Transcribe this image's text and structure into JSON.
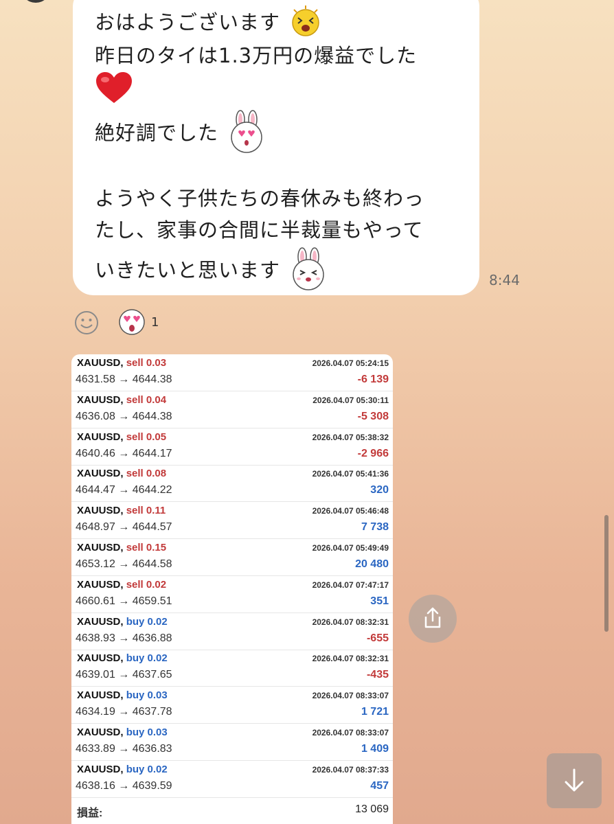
{
  "message": {
    "lines": [
      "おはようございます",
      "昨日のタイは1.3万円の爆益でした",
      "絶好調でした",
      "ようやく子供たちの春休みも終わっ",
      "たし、家事の合間に半裁量もやって",
      "いきたいと思います"
    ],
    "time": "8:44"
  },
  "reactions": {
    "count": "1"
  },
  "trade_screenshot": {
    "trades": [
      {
        "symbol": "XAUUSD,",
        "side": "sell",
        "lot": "0.03",
        "prices": "4631.58 → 4644.38",
        "time": "2026.04.07 05:24:15",
        "profit": "-6 139"
      },
      {
        "symbol": "XAUUSD,",
        "side": "sell",
        "lot": "0.04",
        "prices": "4636.08 → 4644.38",
        "time": "2026.04.07 05:30:11",
        "profit": "-5 308"
      },
      {
        "symbol": "XAUUSD,",
        "side": "sell",
        "lot": "0.05",
        "prices": "4640.46 → 4644.17",
        "time": "2026.04.07 05:38:32",
        "profit": "-2 966"
      },
      {
        "symbol": "XAUUSD,",
        "side": "sell",
        "lot": "0.08",
        "prices": "4644.47 → 4644.22",
        "time": "2026.04.07 05:41:36",
        "profit": "320"
      },
      {
        "symbol": "XAUUSD,",
        "side": "sell",
        "lot": "0.11",
        "prices": "4648.97 → 4644.57",
        "time": "2026.04.07 05:46:48",
        "profit": "7 738"
      },
      {
        "symbol": "XAUUSD,",
        "side": "sell",
        "lot": "0.15",
        "prices": "4653.12 → 4644.58",
        "time": "2026.04.07 05:49:49",
        "profit": "20 480"
      },
      {
        "symbol": "XAUUSD,",
        "side": "sell",
        "lot": "0.02",
        "prices": "4660.61 → 4659.51",
        "time": "2026.04.07 07:47:17",
        "profit": "351"
      },
      {
        "symbol": "XAUUSD,",
        "side": "buy",
        "lot": "0.02",
        "prices": "4638.93 → 4636.88",
        "time": "2026.04.07 08:32:31",
        "profit": "-655"
      },
      {
        "symbol": "XAUUSD,",
        "side": "buy",
        "lot": "0.02",
        "prices": "4639.01 → 4637.65",
        "time": "2026.04.07 08:32:31",
        "profit": "-435"
      },
      {
        "symbol": "XAUUSD,",
        "side": "buy",
        "lot": "0.03",
        "prices": "4634.19 → 4637.78",
        "time": "2026.04.07 08:33:07",
        "profit": "1 721"
      },
      {
        "symbol": "XAUUSD,",
        "side": "buy",
        "lot": "0.03",
        "prices": "4633.89 → 4636.83",
        "time": "2026.04.07 08:33:07",
        "profit": "1 409"
      },
      {
        "symbol": "XAUUSD,",
        "side": "buy",
        "lot": "0.02",
        "prices": "4638.16 → 4639.59",
        "time": "2026.04.07 08:37:33",
        "profit": "457"
      }
    ],
    "total_label": "損益:",
    "total_value": "13 069"
  },
  "colors": {
    "sell": "#c23a3a",
    "buy": "#2a66c2",
    "loss": "#c23a3a",
    "gain": "#2a66c2"
  },
  "icons": {
    "add_reaction": "smiley-outline-icon",
    "reaction": "heart-eyes-bunny-sticker-icon",
    "share": "share-upload-icon",
    "scroll_down": "arrow-down-icon"
  }
}
